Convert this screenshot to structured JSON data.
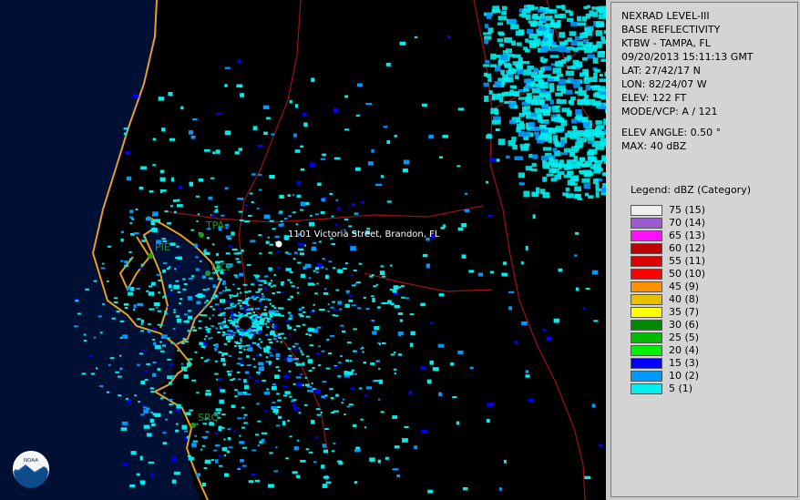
{
  "panel": {
    "lines": [
      "NEXRAD LEVEL-III",
      "BASE REFLECTIVITY",
      "KTBW - TAMPA, FL",
      "09/20/2013 15:11:13 GMT",
      "LAT: 27/42/17 N",
      "LON: 82/24/07 W",
      "ELEV: 122 FT",
      "MODE/VCP: A / 121"
    ],
    "lines2": [
      "ELEV ANGLE: 0.50 °",
      "MAX: 40 dBZ"
    ],
    "legend_title": "Legend: dBZ (Category)",
    "legend": [
      {
        "label": "75  (15)",
        "color": "#f0f0f0"
      },
      {
        "label": "70  (14)",
        "color": "#9a5ccc"
      },
      {
        "label": "65  (13)",
        "color": "#ff10ff"
      },
      {
        "label": "60  (12)",
        "color": "#c00000"
      },
      {
        "label": "55  (11)",
        "color": "#dd0000"
      },
      {
        "label": "50  (10)",
        "color": "#ff0000"
      },
      {
        "label": "45  (9)",
        "color": "#ff9000"
      },
      {
        "label": "40  (8)",
        "color": "#e8c000"
      },
      {
        "label": "35  (7)",
        "color": "#ffff00"
      },
      {
        "label": "30  (6)",
        "color": "#008800"
      },
      {
        "label": "25  (5)",
        "color": "#00bb00"
      },
      {
        "label": "20  (4)",
        "color": "#00ee00"
      },
      {
        "label": "15  (3)",
        "color": "#0000ff"
      },
      {
        "label": "10  (2)",
        "color": "#0099ff"
      },
      {
        "label": "5  (1)",
        "color": "#00eeee"
      }
    ]
  },
  "map": {
    "location_label": "1101 Victoria Street, Brandon, FL",
    "cities": [
      {
        "name": "TPA"
      },
      {
        "name": "PIE"
      },
      {
        "name": "MCF"
      },
      {
        "name": "SRQ"
      }
    ],
    "logo_text": "NOAA",
    "colors": {
      "water": "#001035",
      "land": "#000000",
      "coast": "#e8a020",
      "roads": "#a01010",
      "echo_light": "#00eeee",
      "echo_mid": "#0099ff",
      "echo_strong": "#0000ff"
    }
  }
}
